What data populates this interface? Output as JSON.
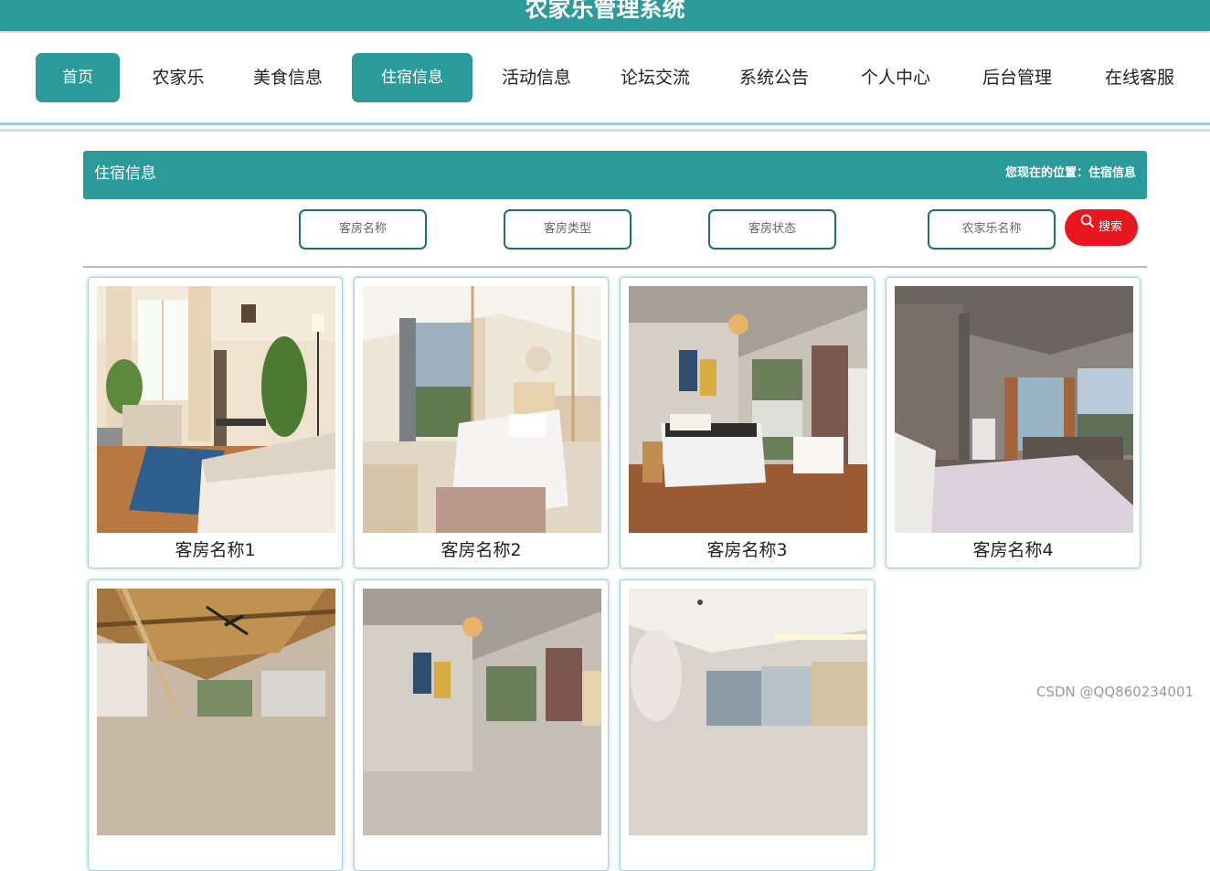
{
  "app_title": "农家乐管理系统",
  "nav": [
    {
      "label": "首页",
      "active": true
    },
    {
      "label": "农家乐",
      "active": false
    },
    {
      "label": "美食信息",
      "active": false
    },
    {
      "label": "住宿信息",
      "active": true
    },
    {
      "label": "活动信息",
      "active": false
    },
    {
      "label": "论坛交流",
      "active": false
    },
    {
      "label": "系统公告",
      "active": false
    },
    {
      "label": "个人中心",
      "active": false
    },
    {
      "label": "后台管理",
      "active": false
    },
    {
      "label": "在线客服",
      "active": false
    }
  ],
  "section": {
    "title": "住宿信息",
    "breadcrumb": "您现在的位置：住宿信息"
  },
  "filters": {
    "room_name_placeholder": "客房名称",
    "room_type_placeholder": "客房类型",
    "room_status_placeholder": "客房状态",
    "farm_name_placeholder": "农家乐名称",
    "search_label": "搜索"
  },
  "rooms": [
    {
      "name": "客房名称1",
      "image": "bedroom-photo-1"
    },
    {
      "name": "客房名称2",
      "image": "bedroom-photo-2"
    },
    {
      "name": "客房名称3",
      "image": "bedroom-photo-3"
    },
    {
      "name": "客房名称4",
      "image": "bedroom-photo-4"
    },
    {
      "name": "",
      "image": "bedroom-photo-5"
    },
    {
      "name": "",
      "image": "bedroom-photo-6"
    },
    {
      "name": "",
      "image": "bedroom-photo-7"
    }
  ],
  "watermark": "CSDN @QQ860234001",
  "colors": {
    "primary": "#2a9a9a",
    "search": "#e8161f",
    "filter_border": "#1d6f74"
  }
}
